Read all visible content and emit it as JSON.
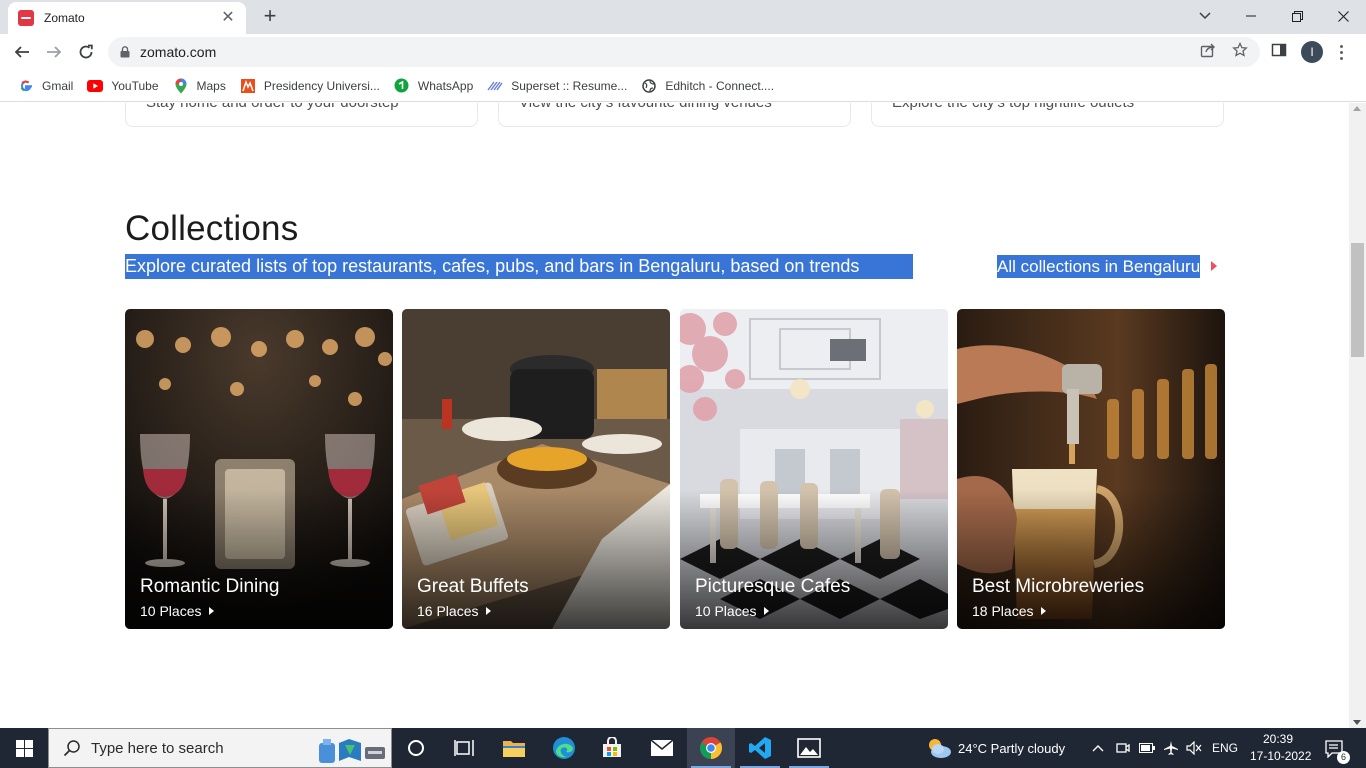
{
  "browser": {
    "tab_title": "Zomato",
    "url": "zomato.com",
    "profile_initial": "I",
    "bookmarks": [
      {
        "label": "Gmail",
        "icon": "gmail-icon"
      },
      {
        "label": "YouTube",
        "icon": "youtube-icon"
      },
      {
        "label": "Maps",
        "icon": "maps-icon"
      },
      {
        "label": "Presidency Universi...",
        "icon": "presidency-icon"
      },
      {
        "label": "WhatsApp",
        "icon": "whatsapp-icon"
      },
      {
        "label": "Superset :: Resume...",
        "icon": "superset-icon"
      },
      {
        "label": "Edhitch - Connect....",
        "icon": "globe-icon"
      }
    ]
  },
  "page": {
    "prev_cards": [
      "Stay home and order to your doorstep",
      "View the city's favourite dining venues",
      "Explore the city's top nightlife outlets"
    ],
    "collections": {
      "title": "Collections",
      "subtitle": "Explore curated lists of top restaurants, cafes, pubs, and bars in Bengaluru, based on trends",
      "all_link": "All collections in Bengaluru",
      "accent_color": "#ef4f5f",
      "selection_color": "#3875d7",
      "cards": [
        {
          "name": "Romantic Dining",
          "count": "10 Places"
        },
        {
          "name": "Great Buffets",
          "count": "16 Places"
        },
        {
          "name": "Picturesque Cafes",
          "count": "10 Places"
        },
        {
          "name": "Best Microbreweries",
          "count": "18 Places"
        }
      ]
    }
  },
  "taskbar": {
    "search_placeholder": "Type here to search",
    "weather": "24°C  Partly cloudy",
    "language": "ENG",
    "time": "20:39",
    "date": "17-10-2022",
    "notification_count": "6"
  }
}
